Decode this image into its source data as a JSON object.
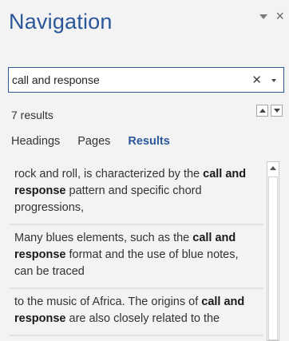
{
  "pane": {
    "title": "Navigation",
    "options_icon": "triangle-down-icon",
    "close_icon": "close-icon",
    "close_glyph": "×"
  },
  "search": {
    "value": "call and response",
    "clear_glyph": "✕",
    "clear_icon": "clear-icon",
    "dropdown_icon": "search-options-icon"
  },
  "results": {
    "count_label": "7 results",
    "prev_icon": "previous-result-icon",
    "next_icon": "next-result-icon"
  },
  "tabs": [
    {
      "label": "Headings",
      "active": false
    },
    {
      "label": "Pages",
      "active": false
    },
    {
      "label": "Results",
      "active": true
    }
  ],
  "result_items": [
    {
      "before": "rock and roll, is characterized by the ",
      "match": "call and response",
      "after": " pattern and specific chord progressions,"
    },
    {
      "before": "Many blues elements, such as the ",
      "match": "call and response",
      "after": " format and the use of blue notes, can be traced"
    },
    {
      "before": "to the music of Africa. The origins of ",
      "match": "call and response",
      "after": " are also closely related to the"
    }
  ],
  "colors": {
    "accent": "#2b579a",
    "background": "#f3f3f3"
  }
}
